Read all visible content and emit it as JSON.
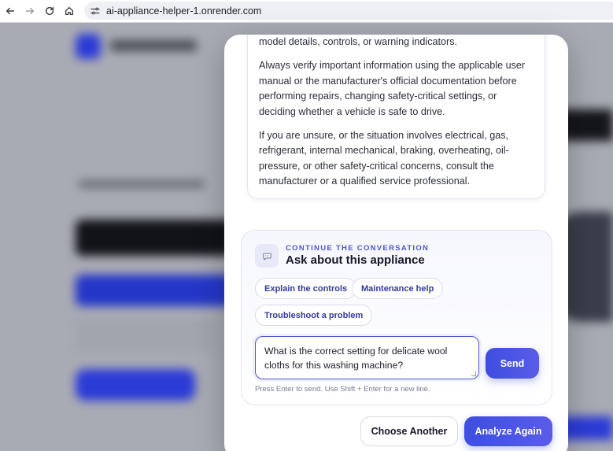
{
  "browser": {
    "url": "ai-appliance-helper-1.onrender.com",
    "icons": [
      "back-arrow-icon",
      "forward-arrow-icon",
      "reload-icon",
      "home-icon",
      "site-settings-icon"
    ]
  },
  "info": {
    "p0": "model details, controls, or warning indicators.",
    "p1": "Always verify important information using the applicable user manual or the manufacturer's official documentation before performing repairs, changing safety-critical settings, or deciding whether a vehicle is safe to drive.",
    "p2": "If you are unsure, or the situation involves electrical, gas, refrigerant, internal mechanical, braking, overheating, oil-pressure, or other safety-critical concerns, consult the manufacturer or a qualified service professional."
  },
  "conversation": {
    "icon": "speech-bubble-icon",
    "eyebrow": "CONTINUE THE CONVERSATION",
    "title": "Ask about this appliance",
    "chips": [
      "Explain the controls",
      "Maintenance help",
      "Troubleshoot a problem"
    ],
    "message_value": "What is the correct setting for delicate wool cloths for this washing machine?",
    "send_label": "Send",
    "hint": "Press Enter to send. Use Shift + Enter for a new line."
  },
  "actions": {
    "choose_another": "Choose Another",
    "analyze_again": "Analyze Again"
  },
  "colors": {
    "accent": "#4450dc",
    "eyebrow": "#4c56c9"
  }
}
